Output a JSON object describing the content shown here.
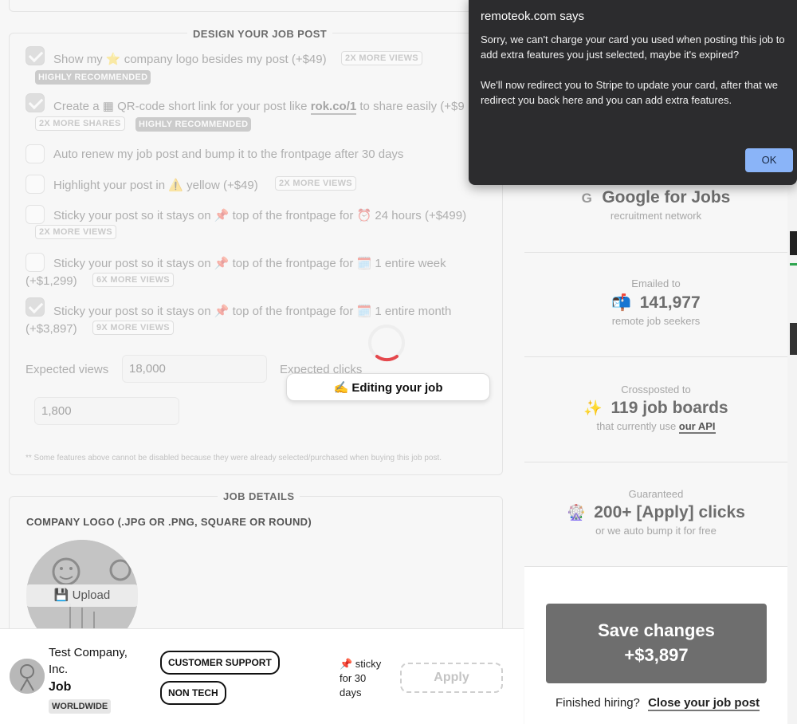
{
  "design_section": {
    "legend": "DESIGN YOUR JOB POST",
    "options": [
      {
        "pre": "Show my",
        "icon": "⭐",
        "post": "company logo besides my post (+$49)",
        "tag": "2X MORE VIEWS",
        "tag2": "HIGHLY RECOMMENDED",
        "checked": true
      },
      {
        "pre": "Create a",
        "icon": "▦",
        "post": "QR-code short link for your post like",
        "link": "rok.co/1",
        "post2": "to share easily (+$9",
        "tag": "2X MORE SHARES",
        "tag2": "HIGHLY RECOMMENDED",
        "checked": true
      },
      {
        "text": "Auto renew my job post and bump it to the frontpage after 30 days",
        "checked": false
      },
      {
        "pre": "Highlight your post in",
        "icon": "⚠️",
        "post": "yellow (+$49)",
        "tag": "2X MORE VIEWS",
        "checked": false
      },
      {
        "pre": "Sticky your post so it stays on",
        "icon": "📌",
        "mid": "top of the frontpage for",
        "icon2": "⏰",
        "post": "24 hours (+$499)",
        "tag": "2X MORE VIEWS",
        "checked": false
      },
      {
        "pre": "Sticky your post so it stays on",
        "icon": "📌",
        "mid": "top of the frontpage for",
        "icon2": "🗓️",
        "post": "1 entire week",
        "price": "(+$1,299)",
        "tag": "6X MORE VIEWS",
        "checked": false
      },
      {
        "pre": "Sticky your post so it stays on",
        "icon": "📌",
        "mid": "top of the frontpage for",
        "icon2": "🗓️",
        "post": "1 entire month",
        "price": "(+$3,897)",
        "tag": "9X MORE VIEWS",
        "checked": true
      }
    ],
    "expected_views_label": "Expected views",
    "expected_views_value": "18,000",
    "expected_clicks_label": "Expected clicks",
    "expected_clicks_value": "1,800",
    "footnote": "** Some features above cannot be disabled because they were already selected/purchased when buying this job post."
  },
  "editing_toast": "✍️ Editing your job",
  "job_details": {
    "legend": "JOB DETAILS",
    "logo_label": "COMPANY LOGO (.JPG OR .PNG, SQUARE OR ROUND)",
    "upload_label": "💾 Upload"
  },
  "preview": {
    "company": "Test Company, Inc.",
    "job": "Job",
    "location": "WORLDWIDE",
    "tags": [
      "CUSTOMER SUPPORT",
      "NON TECH"
    ],
    "sticky_line1": "📌 sticky",
    "sticky_line2": "for 30",
    "sticky_line3": "days",
    "apply": "Apply"
  },
  "stats": {
    "google_big": "Google for Jobs",
    "google_small": "recruitment network",
    "emailed_small": "Emailed to",
    "emailed_big": "141,977",
    "emailed_sub": "remote job seekers",
    "cross_small": "Crossposted to",
    "cross_big": "119 job boards",
    "cross_sub": "that currently use",
    "cross_link": "our API",
    "guaranteed_small": "Guaranteed",
    "guaranteed_big": "200+ [Apply] clicks",
    "guaranteed_sub": "or we auto bump it for free"
  },
  "save": {
    "line1": "Save changes",
    "line2": "+$3,897",
    "finished": "Finished hiring?",
    "close_link": "Close your job post"
  },
  "dialog": {
    "title": "remoteok.com says",
    "para1": "Sorry, we can't charge your card you used when posting this job to add extra features you just selected, maybe it's expired?",
    "para2": "We'll now redirect you to Stripe to update your card, after that we redirect you back here and you can add extra features.",
    "ok": "OK"
  },
  "colors": {
    "dialog_bg": "#2c2c2e",
    "ok_button": "#8ab4f8",
    "save_button": "#6e6e6e",
    "spinner": "#e5484d"
  }
}
